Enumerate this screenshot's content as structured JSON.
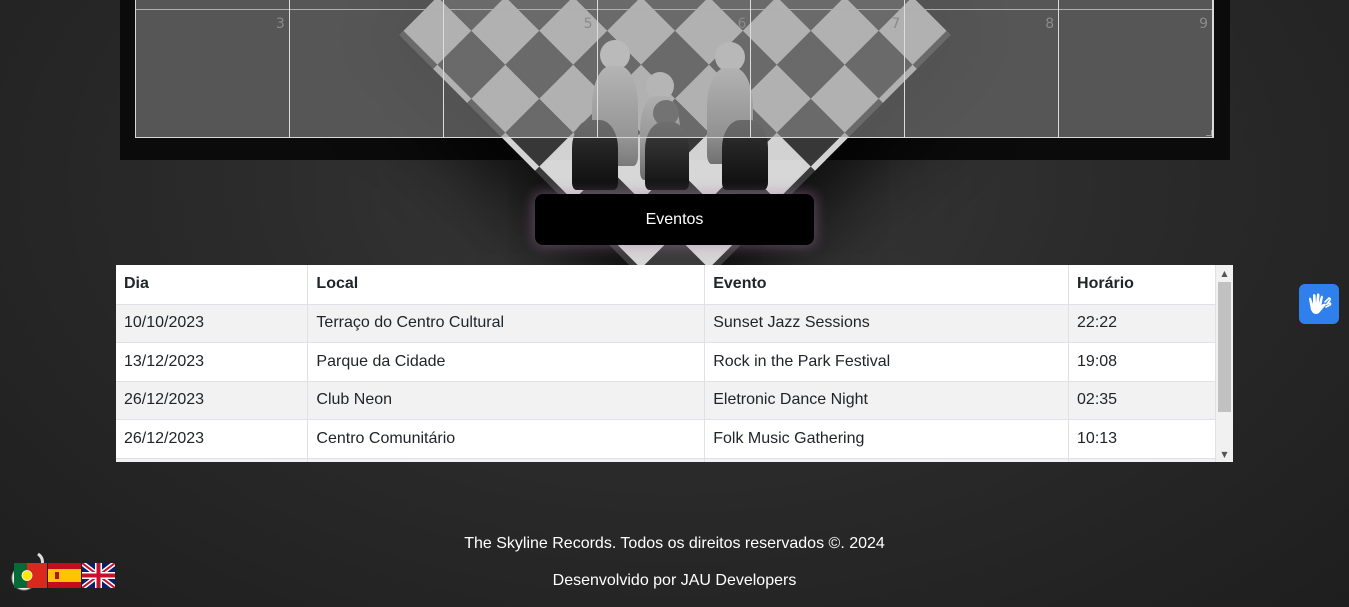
{
  "calendar": {
    "day_numbers": [
      "3",
      "",
      "5",
      "6",
      "7",
      "8",
      "9"
    ]
  },
  "eventos_button": {
    "label": "Eventos"
  },
  "events_table": {
    "headers": [
      "Dia",
      "Local",
      "Evento",
      "Horário"
    ],
    "rows": [
      [
        "10/10/2023",
        "Terraço do Centro Cultural",
        "Sunset Jazz Sessions",
        "22:22"
      ],
      [
        "13/12/2023",
        "Parque da Cidade",
        "Rock in the Park Festival",
        "19:08"
      ],
      [
        "26/12/2023",
        "Club Neon",
        "Eletronic Dance Night",
        "02:35"
      ],
      [
        "26/12/2023",
        "Centro Comunitário",
        "Folk Music Gathering",
        "10:13"
      ]
    ]
  },
  "accessibility": {
    "icon": "sign-language-hands-icon",
    "color": "#2f80ed"
  },
  "footer": {
    "copyright": "The Skyline Records. Todos os direitos reservados ©. 2024",
    "developer": "Desenvolvido por JAU Developers"
  },
  "languages": [
    {
      "icon": "portugal-flag-icon"
    },
    {
      "icon": "spain-flag-icon"
    },
    {
      "icon": "uk-flag-icon"
    }
  ]
}
